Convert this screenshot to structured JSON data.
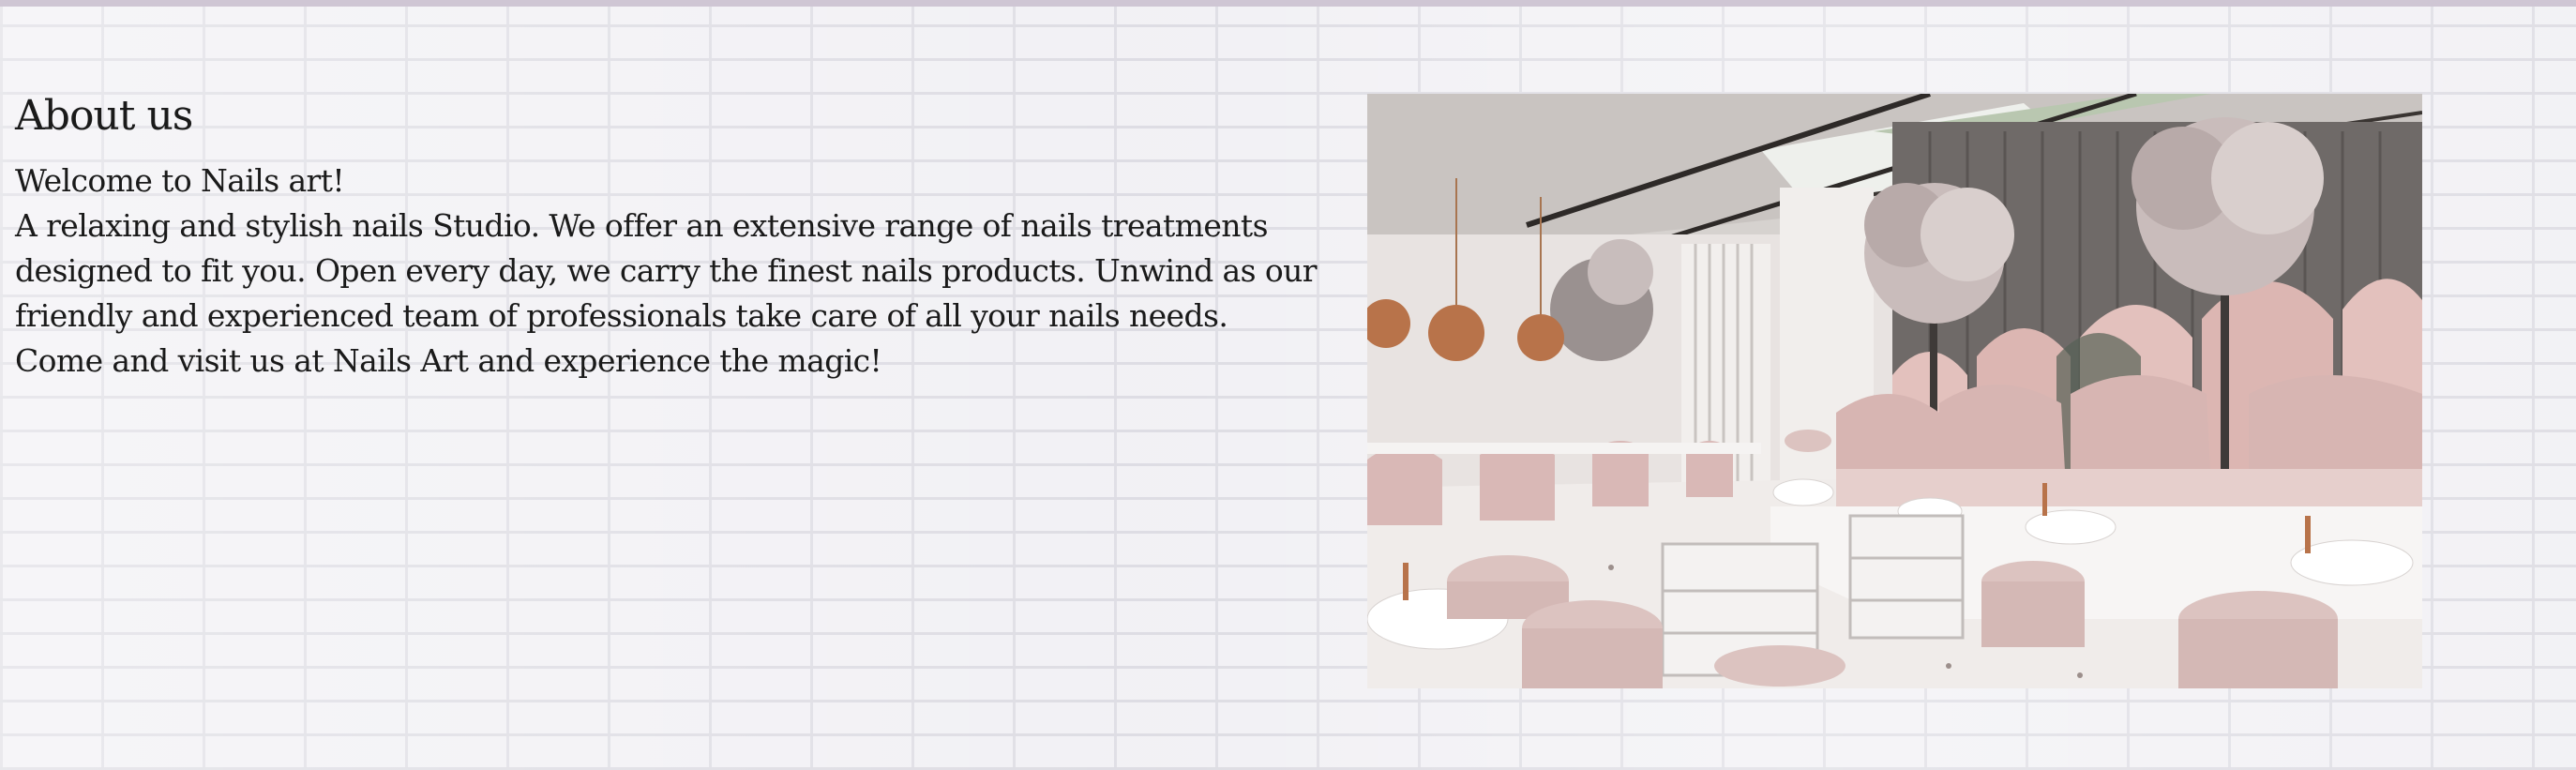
{
  "about": {
    "title": "About us",
    "welcome": "Welcome to Nails art!",
    "description": "A relaxing and stylish nails Studio. We offer an extensive range of nails treatments designed to fit you. Open every day, we carry the finest nails products. Unwind as our friendly and experienced team of professionals take care of all your nails needs.",
    "closing": "Come and visit us at Nails Art and experience the magic!"
  },
  "colors": {
    "background": "#f1f0f4",
    "text": "#1a1a1a",
    "accent_pink": "#d9b8b6",
    "copper": "#b8734a"
  },
  "image": {
    "icon": "salon-interior-photo"
  }
}
